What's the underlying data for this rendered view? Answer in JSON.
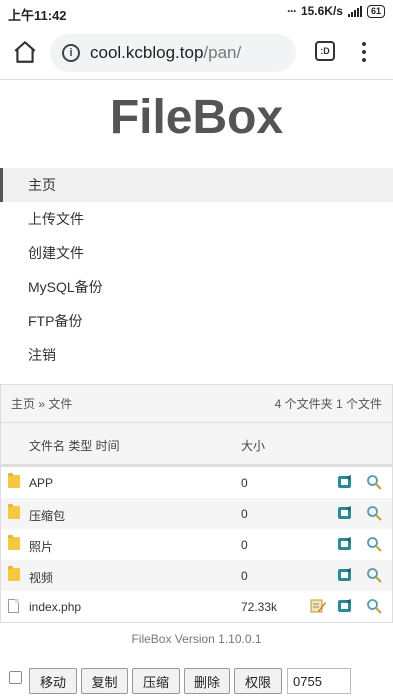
{
  "status_bar": {
    "time": "上午11:42",
    "speed": "15.6K/s",
    "network": "4G",
    "battery": "61"
  },
  "browser": {
    "url_domain": "cool.kcblog.top",
    "url_path": "/pan/",
    "tabs_label": ":D"
  },
  "logo": "FileBox",
  "nav": {
    "items": [
      {
        "label": "主页",
        "active": true
      },
      {
        "label": "上传文件"
      },
      {
        "label": "创建文件"
      },
      {
        "label": "MySQL备份"
      },
      {
        "label": "FTP备份"
      },
      {
        "label": "注销"
      }
    ]
  },
  "panel": {
    "breadcrumb": "主页 » 文件",
    "summary": "4 个文件夹 1 个文件",
    "headers": {
      "name": "文件名 类型 时间",
      "size": "大小"
    },
    "rows": [
      {
        "name": "APP",
        "size": "0",
        "type": "folder"
      },
      {
        "name": "压缩包",
        "size": "0",
        "type": "folder"
      },
      {
        "name": "照片",
        "size": "0",
        "type": "folder"
      },
      {
        "name": "视频",
        "size": "0",
        "type": "folder"
      },
      {
        "name": "index.php",
        "size": "72.33k",
        "type": "file"
      }
    ]
  },
  "version": "FileBox Version 1.10.0.1",
  "toolbar": {
    "move": "移动",
    "copy": "复制",
    "compress": "压缩",
    "delete": "删除",
    "permission": "权限",
    "permission_value": "0755"
  },
  "colors": {
    "folder": "#f5c842",
    "action_teal": "#2a8a99"
  }
}
